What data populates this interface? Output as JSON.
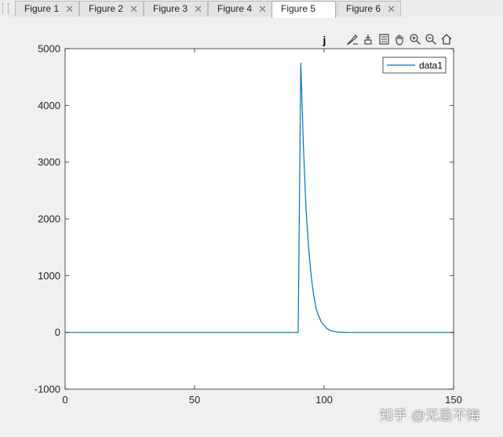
{
  "tabs": [
    {
      "label": "Figure 1",
      "active": false
    },
    {
      "label": "Figure 2",
      "active": false
    },
    {
      "label": "Figure 3",
      "active": false
    },
    {
      "label": "Figure 4",
      "active": false
    },
    {
      "label": "Figure 5",
      "active": true
    },
    {
      "label": "Figure 6",
      "active": false
    }
  ],
  "toolbar": {
    "icons": [
      "brush-icon",
      "data-cursor-icon",
      "legend-toggle-icon",
      "pan-icon",
      "zoom-in-icon",
      "zoom-out-icon",
      "home-icon"
    ]
  },
  "watermark": "知乎 @无忌不悔",
  "colors": {
    "line": "#0072bd",
    "axes": "#262626",
    "plot_bg": "#ffffff",
    "figure_bg": "#f0f0f0"
  },
  "chart_data": {
    "type": "line",
    "title": "j",
    "xlabel": "",
    "ylabel": "",
    "xlim": [
      0,
      150
    ],
    "ylim": [
      -1000,
      5000
    ],
    "xticks": [
      0,
      50,
      100,
      150
    ],
    "yticks": [
      -1000,
      0,
      1000,
      2000,
      3000,
      4000,
      5000
    ],
    "grid": false,
    "legend_position": "top-right",
    "series": [
      {
        "name": "data1",
        "x": [
          0,
          90,
          91,
          92,
          93,
          94,
          95,
          96,
          97,
          98,
          99,
          100,
          101,
          102,
          103,
          104,
          105,
          106,
          108,
          110,
          120,
          150
        ],
        "y": [
          0,
          0,
          4750,
          3300,
          2200,
          1500,
          1000,
          650,
          400,
          280,
          180,
          120,
          75,
          45,
          25,
          15,
          8,
          4,
          1,
          0,
          0,
          0
        ]
      }
    ]
  }
}
